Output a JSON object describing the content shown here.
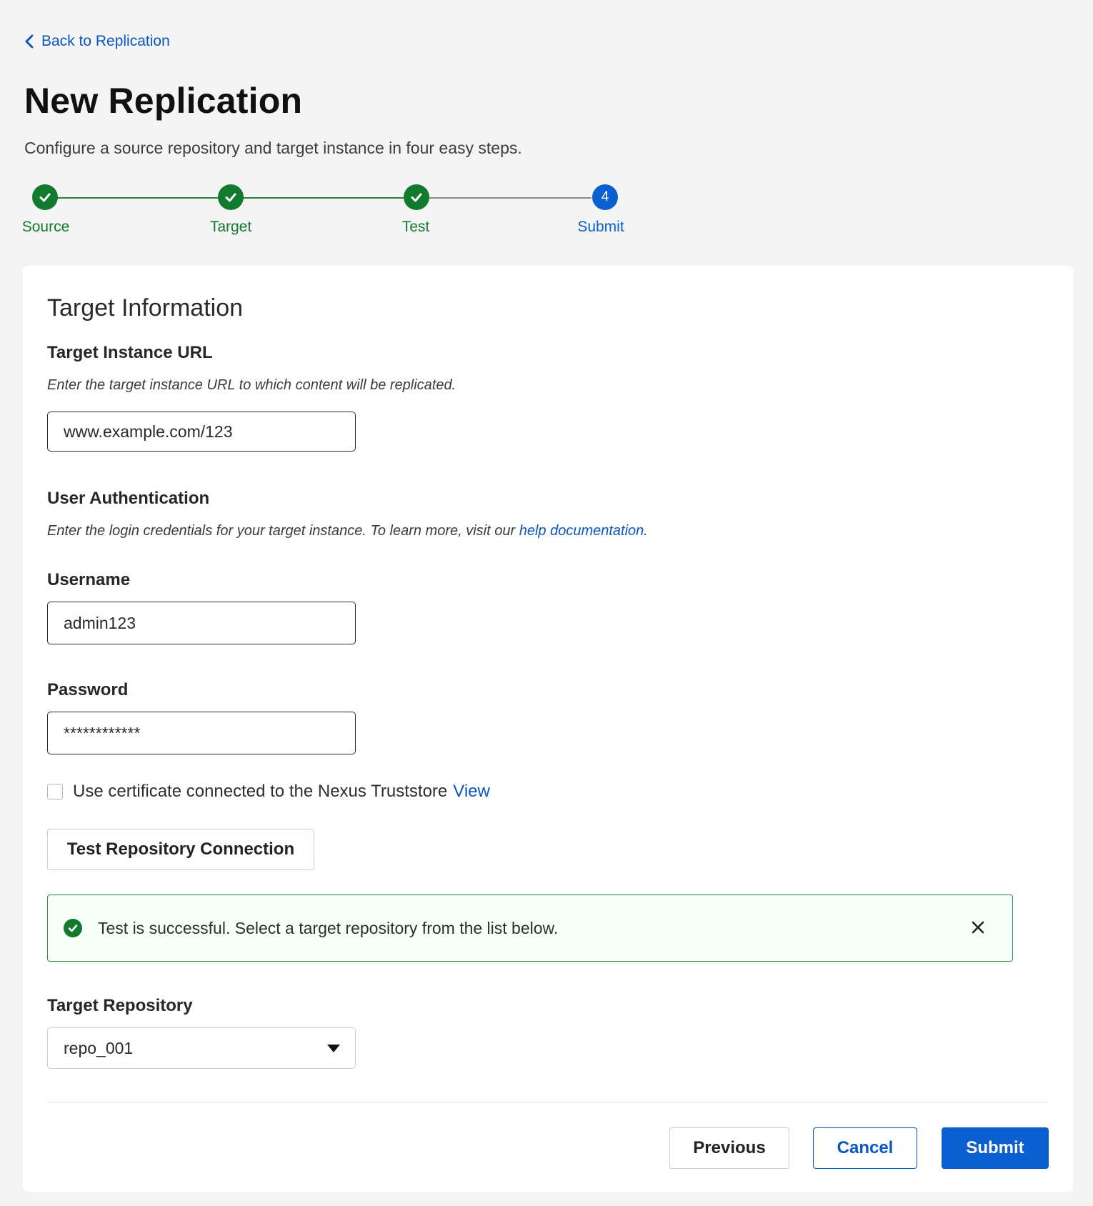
{
  "nav": {
    "back_label": "Back to Replication"
  },
  "header": {
    "title": "New Replication",
    "subtitle": "Configure a source repository and target instance in four easy steps."
  },
  "stepper": {
    "steps": [
      {
        "label": "Source",
        "status": "complete"
      },
      {
        "label": "Target",
        "status": "complete"
      },
      {
        "label": "Test",
        "status": "complete"
      },
      {
        "label": "Submit",
        "status": "active",
        "number": "4"
      }
    ]
  },
  "form": {
    "section_title": "Target Information",
    "target_url": {
      "label": "Target Instance URL",
      "help": "Enter the target instance URL to which content will be replicated.",
      "value": "www.example.com/123"
    },
    "auth": {
      "label": "User Authentication",
      "help": "Enter the login credentials for your target instance. To learn more, visit our",
      "help_link": "help documentation."
    },
    "username": {
      "label": "Username",
      "value": "admin123"
    },
    "password": {
      "label": "Password",
      "value": "************"
    },
    "certificate": {
      "label": "Use certificate connected to the Nexus Truststore",
      "link": "View",
      "checked": false
    },
    "test_button": "Test Repository Connection",
    "alert": {
      "message": "Test is successful. Select a target repository from the list below."
    },
    "target_repo": {
      "label": "Target Repository",
      "selected": "repo_001"
    }
  },
  "actions": {
    "previous": "Previous",
    "cancel": "Cancel",
    "submit": "Submit"
  },
  "colors": {
    "primary": "#0a5fd1",
    "success": "#127a2c",
    "link": "#0a56c2",
    "background": "#f4f4f4"
  }
}
